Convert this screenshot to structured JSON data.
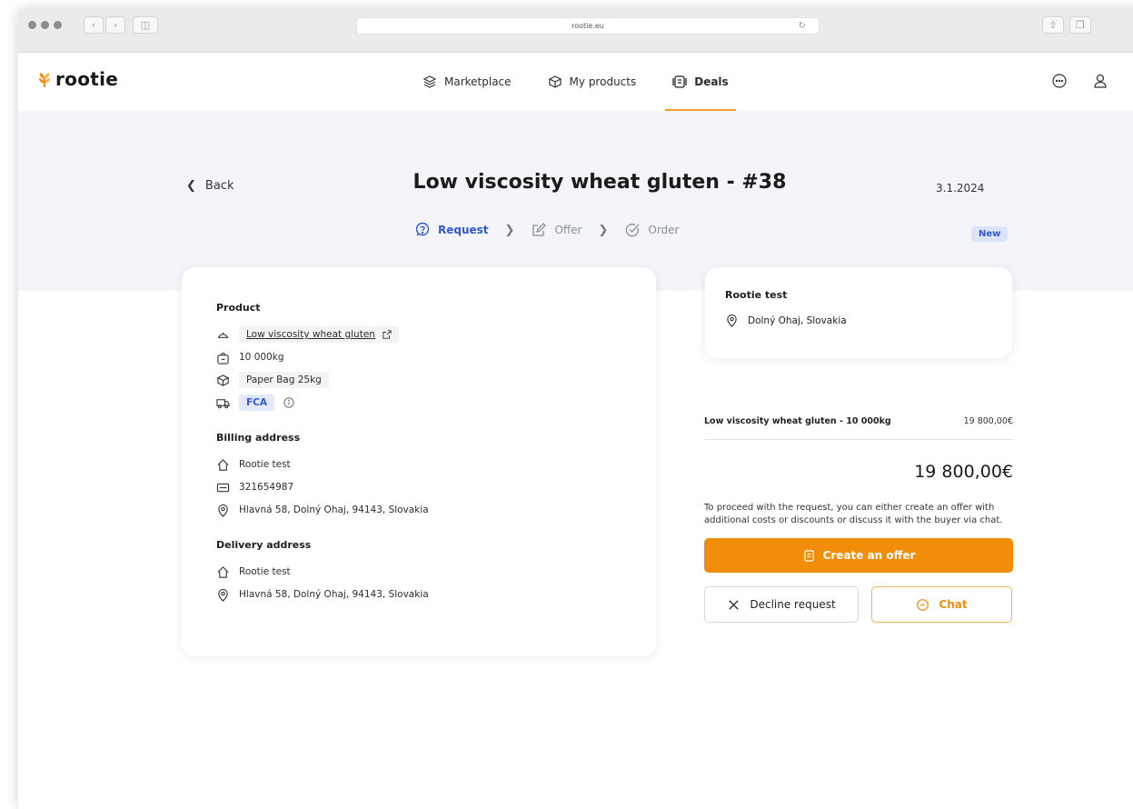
{
  "browser": {
    "url": "rootie.eu"
  },
  "brand": {
    "name": "rootie",
    "accent": "#f28d0a",
    "link_blue": "#3557d6"
  },
  "nav": {
    "items": [
      {
        "label": "Marketplace",
        "icon": "layers-icon"
      },
      {
        "label": "My products",
        "icon": "box-icon"
      },
      {
        "label": "Deals",
        "icon": "deals-icon",
        "active": true
      }
    ]
  },
  "header_icons": [
    "chat-bubble-icon",
    "user-icon"
  ],
  "deal": {
    "back_label": "Back",
    "title": "Low viscosity wheat gluten - #38",
    "date": "3.1.2024",
    "status_badge": "New",
    "steps": [
      {
        "label": "Request",
        "active": true
      },
      {
        "label": "Offer",
        "active": false
      },
      {
        "label": "Order",
        "active": false
      }
    ]
  },
  "product": {
    "section_title": "Product",
    "name": "Low viscosity wheat gluten",
    "quantity": "10 000kg",
    "packaging": "Paper Bag 25kg",
    "incoterm": "FCA"
  },
  "billing": {
    "section_title": "Billing address",
    "company": "Rootie test",
    "id": "321654987",
    "address": "Hlavná 58, Dolný Ohaj, 94143, Slovakia"
  },
  "delivery": {
    "section_title": "Delivery address",
    "company": "Rootie test",
    "address": "Hlavná 58, Dolný Ohaj, 94143, Slovakia"
  },
  "seller": {
    "name": "Rootie test",
    "location": "Dolný Ohaj, Slovakia"
  },
  "summary": {
    "line_label": "Low viscosity wheat gluten - 10 000kg",
    "line_price": "19 800,00€",
    "total": "19 800,00€",
    "note": "To proceed with the request, you can either create an offer with additional costs or discounts or discuss it with the buyer via chat.",
    "create_offer_label": "Create an offer",
    "decline_label": "Decline request",
    "chat_label": "Chat"
  }
}
